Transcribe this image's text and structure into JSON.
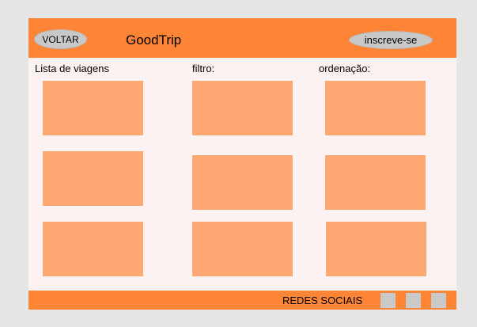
{
  "header": {
    "back_label": "VOLTAR",
    "brand": "GoodTrip",
    "signup_label": "inscreve-se"
  },
  "columns": {
    "list_label": "Lista de viagens",
    "filter_label": "filtro:",
    "order_label": "ordenação:"
  },
  "footer": {
    "social_label": "REDES SOCIAIS",
    "social_icons": [
      "social-placeholder",
      "social-placeholder",
      "social-placeholder"
    ]
  },
  "colors": {
    "header_bar": "#fd8535",
    "card_fill": "#fda872",
    "page_background": "#fcf2f1",
    "button_fill": "#c8c8c8"
  }
}
